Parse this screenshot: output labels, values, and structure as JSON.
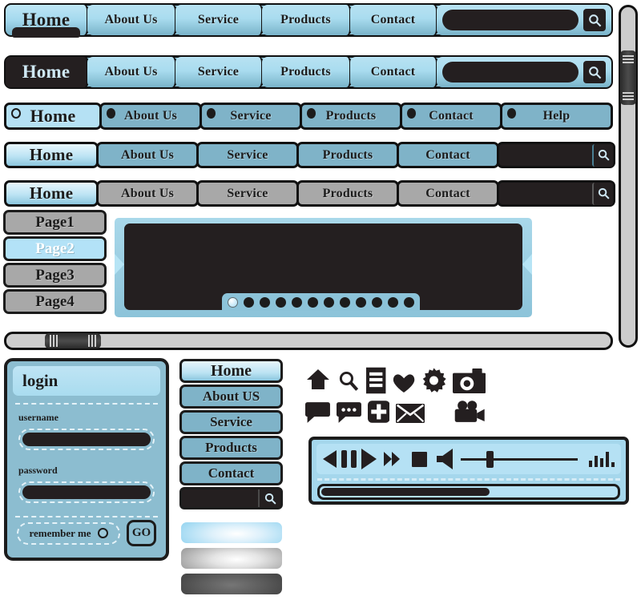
{
  "nav_items": [
    "Home",
    "About Us",
    "Service",
    "Products",
    "Contact"
  ],
  "navbar_1": {
    "tabs": [
      "Home",
      "About Us",
      "Service",
      "Products",
      "Contact"
    ],
    "active": "Home",
    "search_placeholder": "",
    "search_value": "",
    "search_icon": "search-icon"
  },
  "navbar_2": {
    "tabs": [
      "Home",
      "About Us",
      "Service",
      "Products",
      "Contact"
    ],
    "active": "Home",
    "search_value": "",
    "search_icon": "search-icon"
  },
  "navbar_3": {
    "tabs": [
      "Home",
      "About Us",
      "Service",
      "Products",
      "Contact",
      "Help"
    ],
    "active": "Home",
    "bullet_active": "hollow-circle-icon",
    "bullet_inactive": "filled-circle-icon"
  },
  "navbar_4": {
    "tabs": [
      "Home",
      "About Us",
      "Service",
      "Products",
      "Contact"
    ],
    "active": "Home",
    "search_value": "",
    "search_icon": "search-icon"
  },
  "navbar_5": {
    "tabs": [
      "Home",
      "About Us",
      "Service",
      "Products",
      "Contact"
    ],
    "active": "Home",
    "search_value": "",
    "search_icon": "search-icon"
  },
  "pagelist": {
    "items": [
      "Page1",
      "Page2",
      "Page3",
      "Page4"
    ],
    "active": "Page2"
  },
  "content_panel": {
    "dots_total": 12,
    "dots_active_index": 0
  },
  "scrollbars": {
    "vertical": {
      "thumb_position_pct": 12,
      "thumb_size_pct": 16
    },
    "horizontal": {
      "thumb_position_pct": 6,
      "thumb_size_pct": 9
    }
  },
  "login": {
    "title": "login",
    "username_label": "username",
    "username_value": "",
    "password_label": "password",
    "password_value": "",
    "remember_label": "remember me",
    "remember_checked": false,
    "submit_label": "GO"
  },
  "vmenu": {
    "items": [
      "Home",
      "About US",
      "Service",
      "Products",
      "Contact"
    ],
    "active": "Home",
    "search_value": "",
    "search_icon": "search-icon"
  },
  "swatches": [
    {
      "name": "blue-gradient-button"
    },
    {
      "name": "silver-gradient-button"
    },
    {
      "name": "dark-gradient-button"
    }
  ],
  "icons": {
    "row1": [
      "home-icon",
      "search-icon",
      "list-document-icon",
      "heart-icon",
      "gear-icon",
      "camera-icon"
    ],
    "row2": [
      "speech-bubble-icon",
      "chat-dots-icon",
      "plus-square-icon",
      "envelope-icon",
      "video-camera-icon"
    ]
  },
  "player": {
    "controls": [
      "rewind-icon",
      "pause-icon",
      "play-icon",
      "fast-forward-icon",
      "stop-icon",
      "volume-icon"
    ],
    "volume_pct": 22,
    "equalizer_bars": [
      40,
      70,
      55,
      95,
      30
    ],
    "progress_pct": 57
  },
  "colors": {
    "accent_light": "#b5e1f4",
    "accent": "#8cc3d9",
    "accent_mid": "#7fb3c8",
    "dark": "#241f20",
    "gray": "#a8a8a8",
    "outline": "#1c1c1c"
  }
}
